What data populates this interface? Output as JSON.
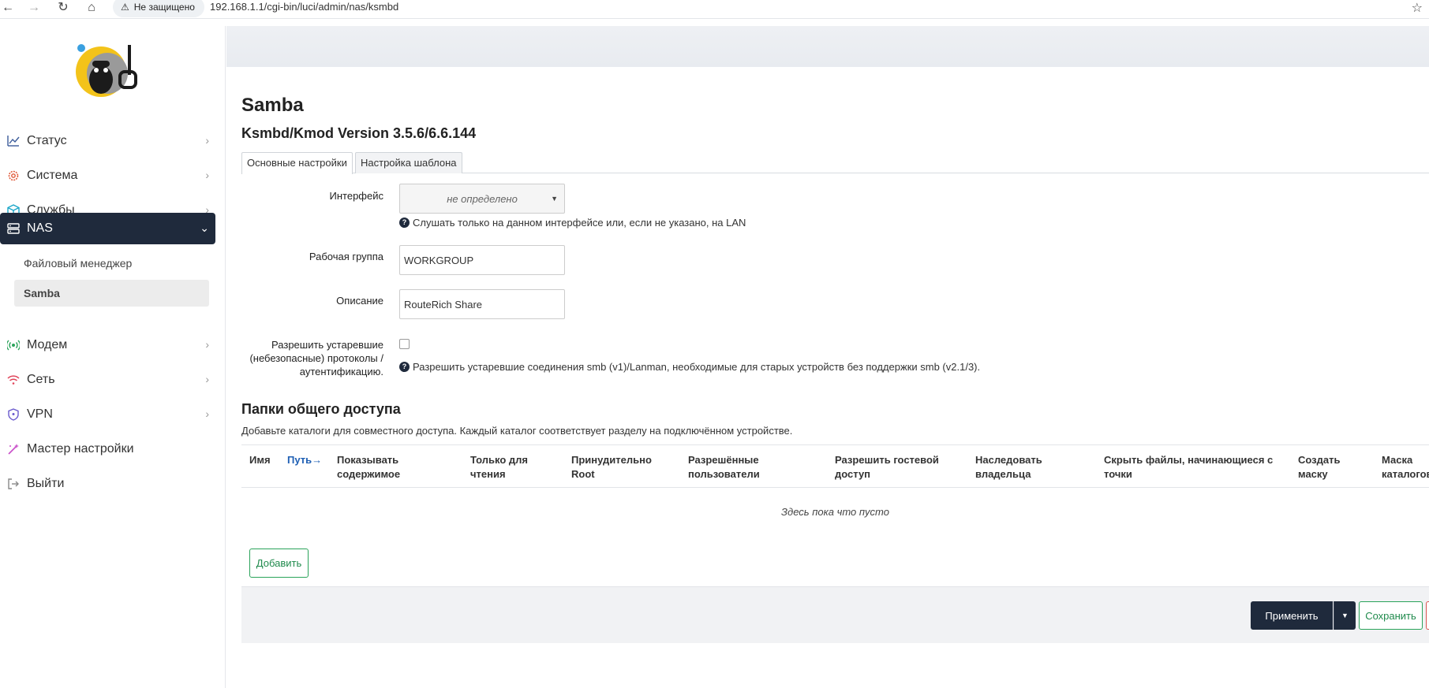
{
  "browser": {
    "security_label": "Не защищено",
    "url": "192.168.1.1/cgi-bin/luci/admin/nas/ksmbd"
  },
  "sidebar": {
    "items": [
      {
        "label": "Статус",
        "icon": "chart-line-icon"
      },
      {
        "label": "Система",
        "icon": "gear-icon"
      },
      {
        "label": "Службы",
        "icon": "cube-icon"
      },
      {
        "label": "NAS",
        "icon": "server-icon"
      },
      {
        "label": "Модем",
        "icon": "broadcast-icon"
      },
      {
        "label": "Сеть",
        "icon": "wifi-icon"
      },
      {
        "label": "VPN",
        "icon": "shield-icon"
      },
      {
        "label": "Мастер настройки",
        "icon": "magic-wand-icon"
      },
      {
        "label": "Выйти",
        "icon": "logout-icon"
      }
    ],
    "submenu": [
      {
        "label": "Файловый менеджер"
      },
      {
        "label": "Samba"
      }
    ]
  },
  "main": {
    "title": "Samba",
    "subtitle": "Ksmbd/Kmod Version 3.5.6/6.6.144",
    "tabs": [
      {
        "label": "Основные настройки"
      },
      {
        "label": "Настройка шаблона"
      }
    ],
    "form": {
      "interface_label": "Интерфейс",
      "interface_value": "не определено",
      "interface_hint": "Слушать только на данном интерфейсе или, если не указано, на LAN",
      "workgroup_label": "Рабочая группа",
      "workgroup_value": "WORKGROUP",
      "description_label": "Описание",
      "description_value": "RouteRich Share",
      "legacy_label_1": "Разрешить устаревшие",
      "legacy_label_2": "(небезопасные) протоколы /",
      "legacy_label_3": "аутентификацию.",
      "legacy_hint": "Разрешить устаревшие соединения smb (v1)/Lanman, необходимые для старых устройств без поддержки smb (v2.1/3)."
    },
    "shares": {
      "title": "Папки общего доступа",
      "description": "Добавьте каталоги для совместного доступа. Каждый каталог соответствует разделу на подключённом устройстве.",
      "columns": [
        {
          "l1": "Имя",
          "l2": ""
        },
        {
          "l1": "Путь→",
          "l2": ""
        },
        {
          "l1": "Показывать",
          "l2": "содержимое"
        },
        {
          "l1": "Только для",
          "l2": "чтения"
        },
        {
          "l1": "Принудительно",
          "l2": "Root"
        },
        {
          "l1": "Разрешённые",
          "l2": "пользователи"
        },
        {
          "l1": "Разрешить гостевой",
          "l2": "доступ"
        },
        {
          "l1": "Наследовать",
          "l2": "владельца"
        },
        {
          "l1": "Скрыть файлы, начинающиеся с",
          "l2": "точки"
        },
        {
          "l1": "Создать",
          "l2": "маску"
        },
        {
          "l1": "Маска",
          "l2": "каталогов"
        }
      ],
      "empty": "Здесь пока что пусто",
      "add_label": "Добавить"
    },
    "footer": {
      "apply_label": "Применить",
      "save_label": "Сохранить"
    }
  }
}
